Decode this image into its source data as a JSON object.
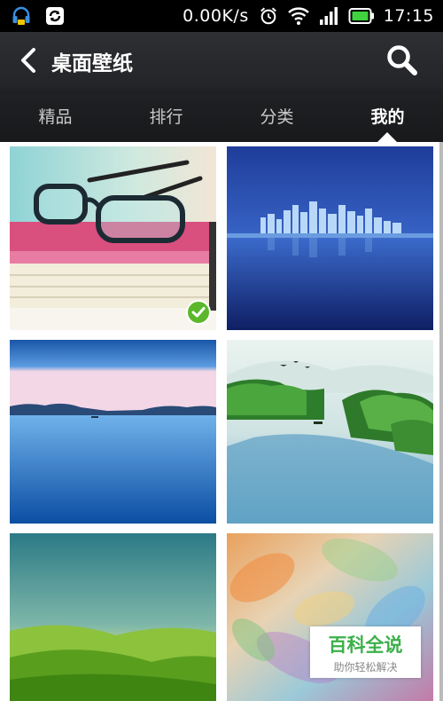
{
  "status_bar": {
    "net_speed": "0.00K/s",
    "time": "17:15",
    "left_icons": [
      "headset-notification-icon",
      "sync-notification-icon"
    ],
    "right_icons": [
      "alarm-icon",
      "wifi-icon",
      "signal-icon",
      "battery-icon"
    ]
  },
  "header": {
    "title": "桌面壁纸",
    "back_icon": "chevron-left-icon",
    "search_icon": "search-icon"
  },
  "tabs": [
    {
      "label": "精品",
      "active": false
    },
    {
      "label": "排行",
      "active": false
    },
    {
      "label": "分类",
      "active": false
    },
    {
      "label": "我的",
      "active": true
    }
  ],
  "wallpapers": [
    {
      "name": "glasses-on-book",
      "applied": true
    },
    {
      "name": "city-skyline-night",
      "applied": false
    },
    {
      "name": "calm-lake-horizon",
      "applied": false
    },
    {
      "name": "misty-river-islands",
      "applied": false
    },
    {
      "name": "green-hills",
      "applied": false
    },
    {
      "name": "colorful-leaves",
      "applied": false
    }
  ],
  "watermark": {
    "main": "百科全说",
    "sub": "助你轻松解决"
  },
  "colors": {
    "applied_check": "#5cb82a",
    "watermark_green": "#3bb04a"
  }
}
